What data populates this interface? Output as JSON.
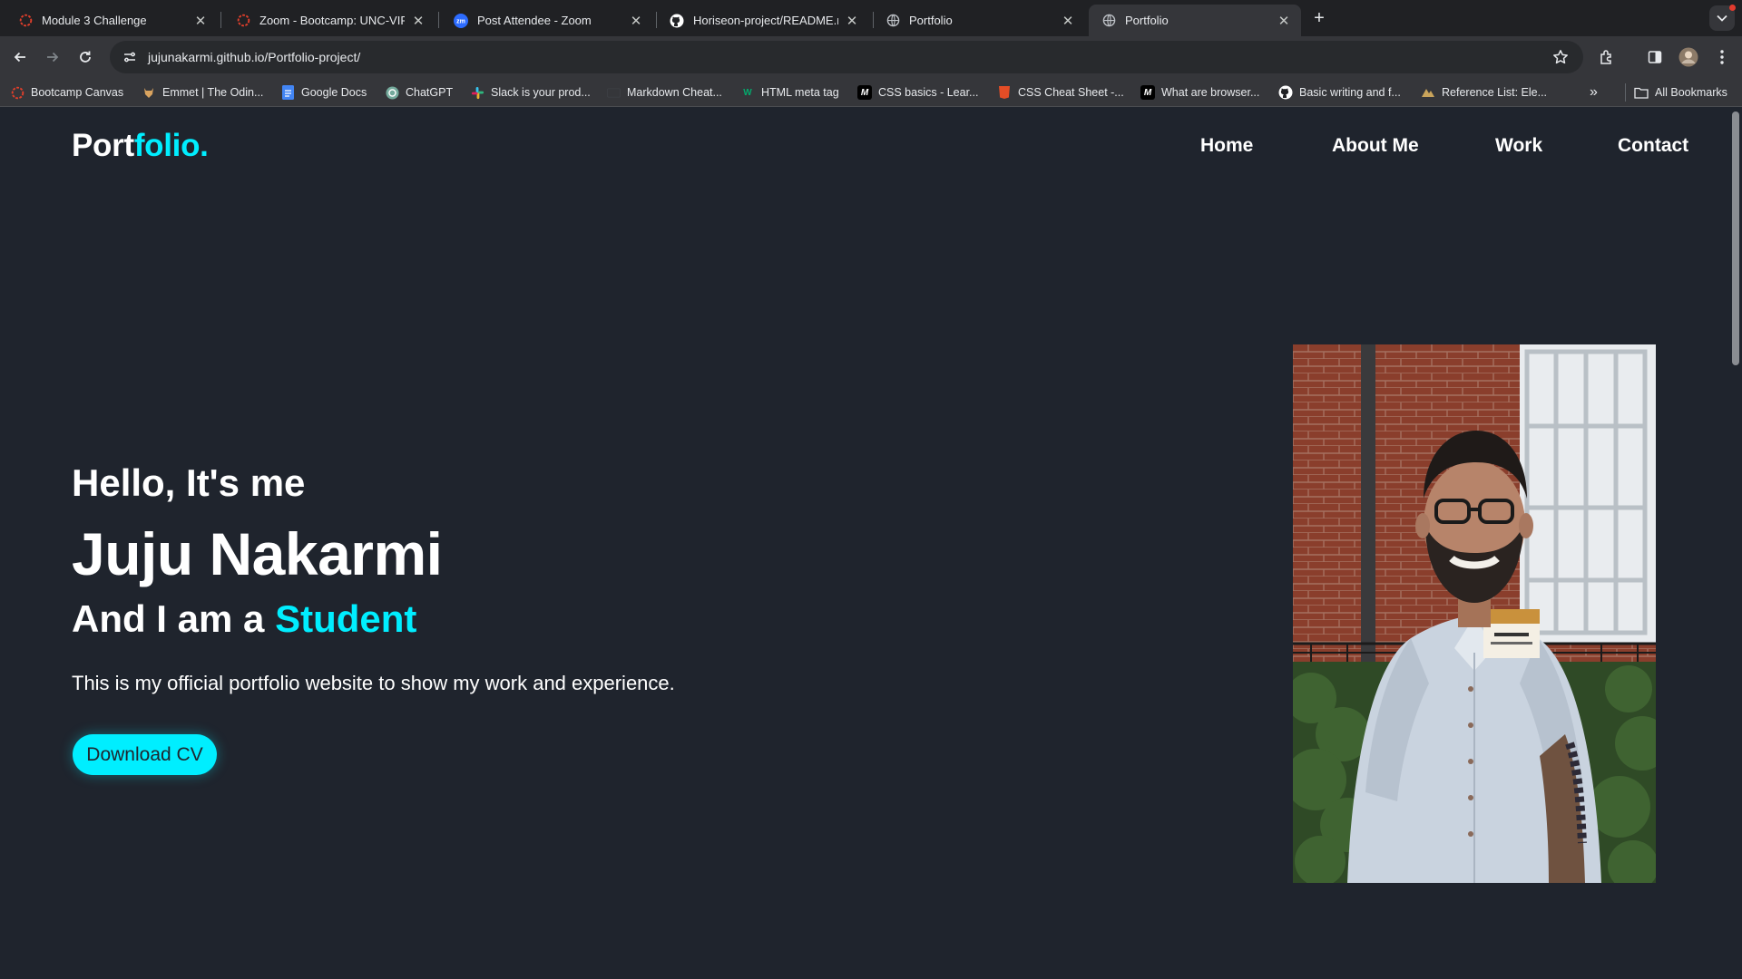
{
  "browser": {
    "tabs": [
      {
        "title": "Module 3 Challenge",
        "icon": "canvas-icon",
        "active": false
      },
      {
        "title": "Zoom - Bootcamp: UNC-VIRT",
        "icon": "canvas-icon",
        "active": false
      },
      {
        "title": "Post Attendee - Zoom",
        "icon": "zoom-icon",
        "active": false
      },
      {
        "title": "Horiseon-project/README.m",
        "icon": "github-icon",
        "active": false
      },
      {
        "title": "Portfolio",
        "icon": "globe-icon",
        "active": false
      },
      {
        "title": "Portfolio",
        "icon": "globe-icon",
        "active": true
      }
    ],
    "url_host": "jujunakarmi.github.io",
    "url_path": "/Portfolio-project/",
    "bookmarks": [
      {
        "label": "Bootcamp Canvas",
        "icon": "canvas-icon"
      },
      {
        "label": "Emmet | The Odin...",
        "icon": "odin-icon"
      },
      {
        "label": "Google Docs",
        "icon": "docs-icon"
      },
      {
        "label": "ChatGPT",
        "icon": "chatgpt-icon"
      },
      {
        "label": "Slack is your prod...",
        "icon": "slack-icon"
      },
      {
        "label": "Markdown Cheat...",
        "icon": "markdown-icon"
      },
      {
        "label": "HTML meta tag",
        "icon": "w3-icon"
      },
      {
        "label": "CSS basics - Lear...",
        "icon": "mdn-icon"
      },
      {
        "label": "CSS Cheat Sheet -...",
        "icon": "css-icon"
      },
      {
        "label": "What are browser...",
        "icon": "mdn-icon"
      },
      {
        "label": "Basic writing and f...",
        "icon": "github-icon"
      },
      {
        "label": "Reference List: Ele...",
        "icon": "reference-icon"
      }
    ],
    "all_bookmarks_label": "All Bookmarks"
  },
  "site": {
    "logo_main": "Port",
    "logo_accent": "folio.",
    "nav": [
      "Home",
      "About Me",
      "Work",
      "Contact"
    ],
    "hero": {
      "greeting": "Hello, It's me",
      "name": "Juju Nakarmi",
      "role_prefix": "And I am a ",
      "role_accent": "Student",
      "tagline": "This is my official portfolio website to show my work and experience.",
      "cta_label": "Download CV"
    }
  },
  "colors": {
    "page_bg": "#1f242d",
    "accent": "#00eeff",
    "chrome_bg": "#35363a",
    "tabstrip_bg": "#202124"
  }
}
